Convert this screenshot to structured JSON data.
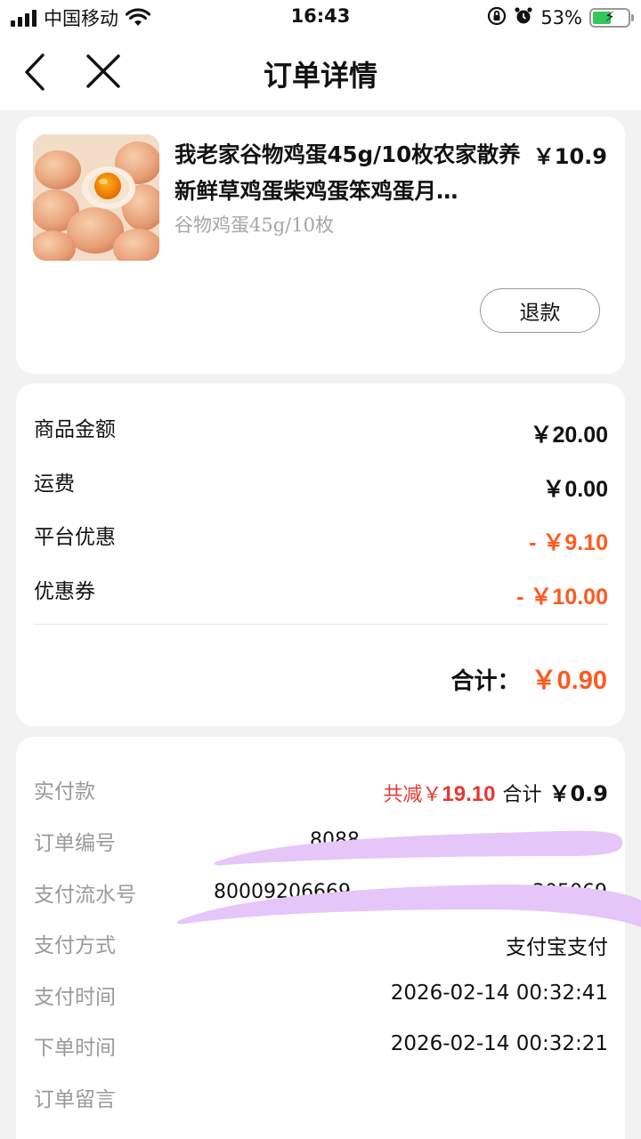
{
  "status_bar": {
    "carrier": "中国移动",
    "time": "16:43",
    "battery_pct": "53%",
    "battery_level": 0.53
  },
  "nav": {
    "title": "订单详情"
  },
  "product": {
    "title": "我老家谷物鸡蛋45g/10枚农家散养新鲜草鸡蛋柴鸡蛋笨鸡蛋月…",
    "price": "￥10.9",
    "spec": "谷物鸡蛋45g/10枚",
    "refund_label": "退款"
  },
  "price_summary": {
    "rows": [
      {
        "label": "商品金额",
        "value": "￥20.00",
        "highlight": false
      },
      {
        "label": "运费",
        "value": "￥0.00",
        "highlight": false
      },
      {
        "label": "平台优惠",
        "value": "-  ￥9.10",
        "highlight": true
      },
      {
        "label": "优惠券",
        "value": "- ￥10.00",
        "highlight": true
      }
    ],
    "total_label": "合计：",
    "total_value": "￥0.90"
  },
  "order_info": {
    "paid_label": "实付款",
    "paid_reduce_prefix": "共减￥",
    "paid_reduce_value": "19.10",
    "paid_sum_label": "合计",
    "paid_sum_value": "￥0.9",
    "order_no_label": "订单编号",
    "order_no_visible": "8088",
    "serial_label": "支付流水号",
    "serial_visible_start": "80009206669",
    "serial_visible_end": "305069",
    "pay_method_label": "支付方式",
    "pay_method_value": "支付宝支付",
    "pay_time_label": "支付时间",
    "pay_time_value": "2026-02-14 00:32:41",
    "order_time_label": "下单时间",
    "order_time_value": "2026-02-14 00:32:21",
    "note_label": "订单留言"
  },
  "colors": {
    "accent_orange": "#ff5a1f",
    "discount_red": "#e8372f",
    "redaction_purple": "#e6c6f8"
  }
}
